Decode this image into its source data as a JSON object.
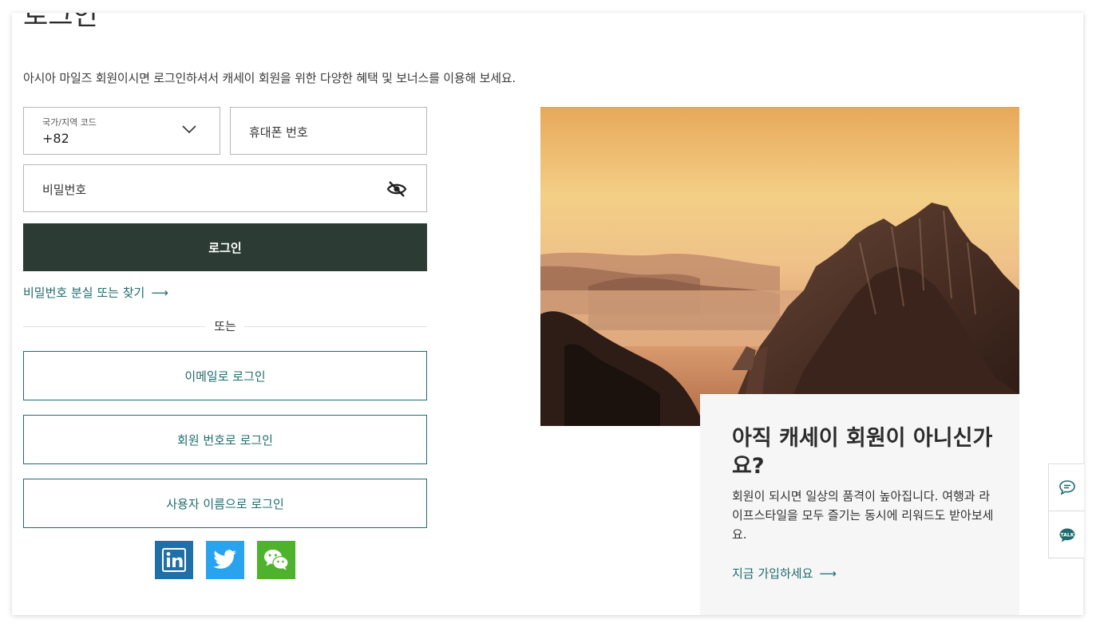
{
  "page": {
    "title": "로그인",
    "intro": "아시아 마일즈 회원이시면 로그인하셔서 캐세이 회원을 위한 다양한 혜택 및 보너스를 이용해 보세요."
  },
  "form": {
    "country_label": "국가/지역 코드",
    "country_value": "+82",
    "phone_placeholder": "휴대폰 번호",
    "password_placeholder": "비밀번호",
    "login_label": "로그인",
    "forgot_label": "비밀번호 분실 또는 찾기",
    "arrow": "⟶",
    "or_label": "또는"
  },
  "alt_logins": [
    {
      "label": "이메일로 로그인"
    },
    {
      "label": "회원 번호로 로그인"
    },
    {
      "label": "사용자 이름으로 로그인"
    }
  ],
  "social": [
    "linkedin-icon",
    "twitter-icon",
    "wechat-icon"
  ],
  "promo": {
    "heading": "아직 캐세이 회원이 아니신가요?",
    "body": "회원이 되시면 일상의 품격이 높아집니다. 여행과 라이프스타일을 모두 즐기는 동시에 리워드도 받아보세요.",
    "join_label": "지금 가입하세요",
    "arrow": "⟶"
  },
  "side_tools": {
    "chat_icon": "chat-bubble-icon",
    "talk_icon": "talk-icon",
    "talk_text": "TALK"
  },
  "colors": {
    "primary_dark": "#2c3c35",
    "accent_teal": "#1f6b6e",
    "linkedin": "#1f6fa8",
    "twitter": "#2aa3ef",
    "wechat": "#4fb22d"
  }
}
